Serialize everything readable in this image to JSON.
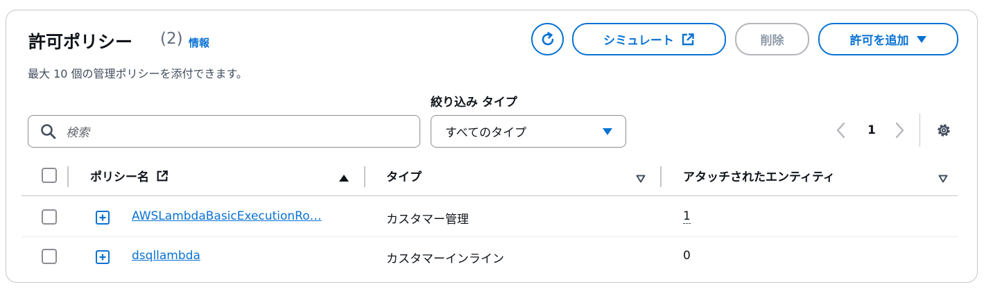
{
  "header": {
    "title": "許可ポリシー",
    "count": "(2)",
    "info_link": "情報",
    "description": "最大 10 個の管理ポリシーを添付できます。"
  },
  "actions": {
    "simulate_label": "シミュレート",
    "delete_label": "削除",
    "add_permissions_label": "許可を追加"
  },
  "filters": {
    "search_placeholder": "検索",
    "type_filter_label": "絞り込み タイプ",
    "type_filter_value": "すべてのタイプ"
  },
  "pagination": {
    "current_page": "1"
  },
  "table": {
    "columns": [
      "ポリシー名",
      "タイプ",
      "アタッチされたエンティティ"
    ],
    "rows": [
      {
        "name": "AWSLambdaBasicExecutionRo…",
        "type": "カスタマー管理",
        "attached": "1"
      },
      {
        "name": "dsqllambda",
        "type": "カスタマーインライン",
        "attached": "0"
      }
    ]
  },
  "colors": {
    "accent": "#0972d3",
    "border": "#c6c6cd",
    "text": "#0f141a"
  }
}
